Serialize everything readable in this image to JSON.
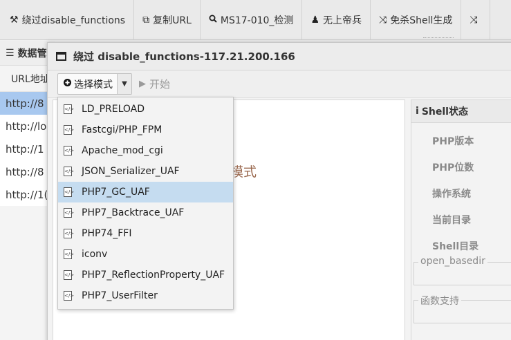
{
  "toolbar": {
    "buttons": [
      {
        "label": "绕过disable_functions",
        "icon": "hammer-icon",
        "glyph": "⚒"
      },
      {
        "label": "复制URL",
        "icon": "copy-icon",
        "glyph": "⧉"
      },
      {
        "label": "MS17-010_检测",
        "icon": "search-icon",
        "glyph": "🔍︎"
      },
      {
        "label": "无上帝兵",
        "icon": "person-icon",
        "glyph": "♟"
      },
      {
        "label": "免杀Shell生成",
        "icon": "shuffle-icon",
        "glyph": "⤨"
      }
    ],
    "overflow_glyph": "⤨"
  },
  "left_panel": {
    "header": "数据管理",
    "header_glyph": "☰",
    "url_label": "URL地址",
    "rows": [
      "http://8",
      "http://lo",
      "http://1",
      "http://8",
      "http://1("
    ]
  },
  "dialog": {
    "title": "绕过 disable_functions-117.21.200.166",
    "mode_button": "选择模式",
    "mode_glyph": "⊕",
    "caret_glyph": "▼",
    "start_button": "开始",
    "start_glyph": "▶",
    "hint": "钮,选择模式"
  },
  "shell_panel": {
    "header": "Shell状态",
    "header_glyph": "i",
    "labels": [
      "PHP版本",
      "PHP位数",
      "操作系统",
      "当前目录",
      "Shell目录"
    ],
    "open_basedir": "open_basedir",
    "func_support": "函数支持"
  },
  "menu": {
    "selected_index": 4,
    "items": [
      "LD_PRELOAD",
      "Fastcgi/PHP_FPM",
      "Apache_mod_cgi",
      "JSON_Serializer_UAF",
      "PHP7_GC_UAF",
      "PHP7_Backtrace_UAF",
      "PHP74_FFI",
      "iconv",
      "PHP7_ReflectionProperty_UAF",
      "PHP7_UserFilter"
    ],
    "file_icon_glyph": "</>"
  }
}
